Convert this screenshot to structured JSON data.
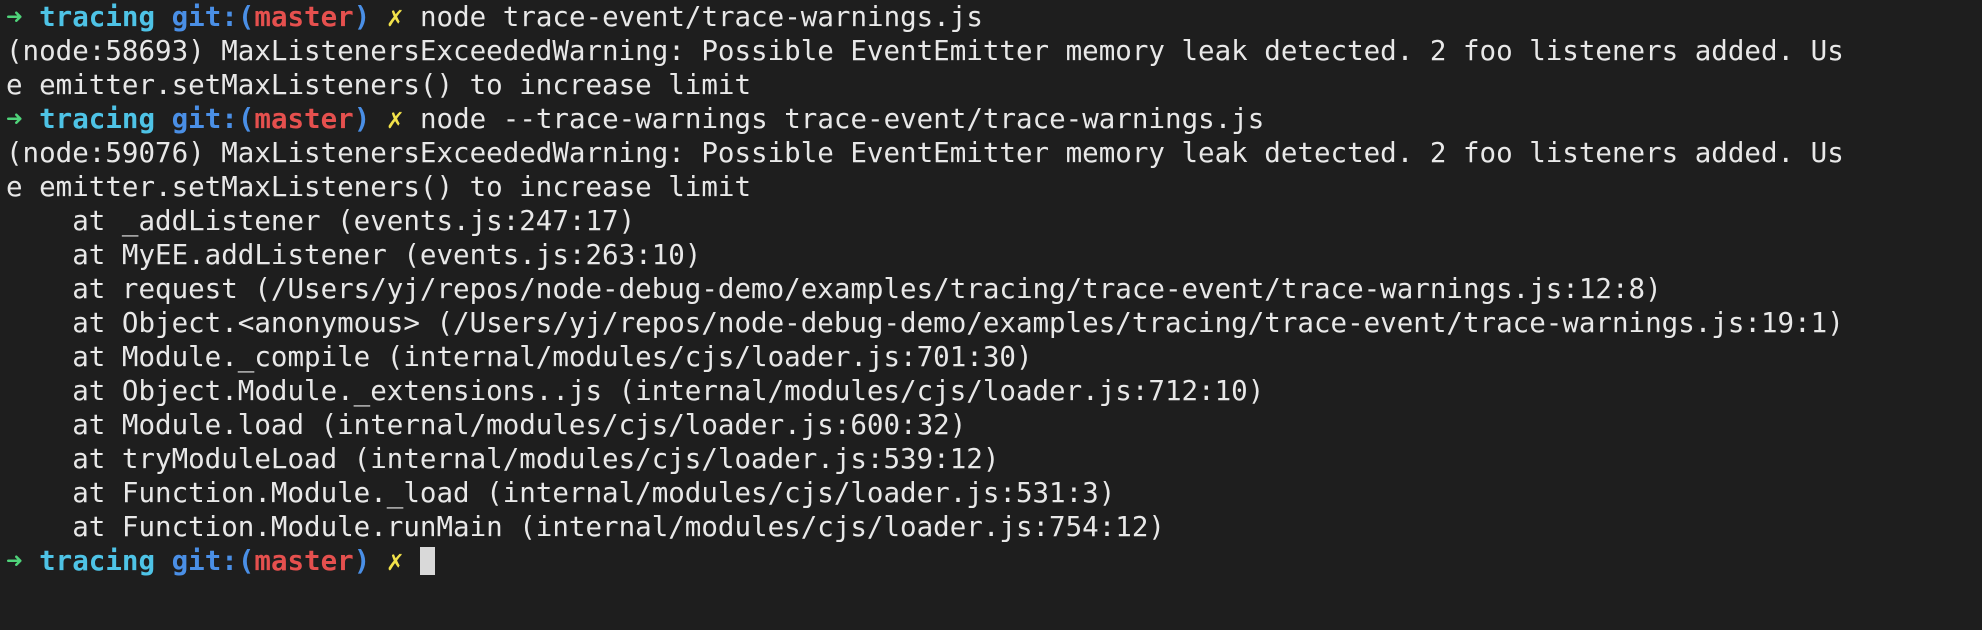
{
  "terminal": {
    "lines": [
      {
        "type": "prompt",
        "arrow": "➜",
        "dir": "tracing",
        "git_open": "git:(",
        "branch": "master",
        "git_close": ")",
        "dirty": "✗",
        "command": "node trace-event/trace-warnings.js"
      },
      {
        "type": "output",
        "text": "(node:58693) MaxListenersExceededWarning: Possible EventEmitter memory leak detected. 2 foo listeners added. Us"
      },
      {
        "type": "output",
        "text": "e emitter.setMaxListeners() to increase limit"
      },
      {
        "type": "prompt",
        "arrow": "➜",
        "dir": "tracing",
        "git_open": "git:(",
        "branch": "master",
        "git_close": ")",
        "dirty": "✗",
        "command": "node --trace-warnings trace-event/trace-warnings.js"
      },
      {
        "type": "output",
        "text": "(node:59076) MaxListenersExceededWarning: Possible EventEmitter memory leak detected. 2 foo listeners added. Us"
      },
      {
        "type": "output",
        "text": "e emitter.setMaxListeners() to increase limit"
      },
      {
        "type": "output",
        "text": "    at _addListener (events.js:247:17)"
      },
      {
        "type": "output",
        "text": "    at MyEE.addListener (events.js:263:10)"
      },
      {
        "type": "output",
        "text": "    at request (/Users/yj/repos/node-debug-demo/examples/tracing/trace-event/trace-warnings.js:12:8)"
      },
      {
        "type": "output",
        "text": "    at Object.<anonymous> (/Users/yj/repos/node-debug-demo/examples/tracing/trace-event/trace-warnings.js:19:1)"
      },
      {
        "type": "output",
        "text": "    at Module._compile (internal/modules/cjs/loader.js:701:30)"
      },
      {
        "type": "output",
        "text": "    at Object.Module._extensions..js (internal/modules/cjs/loader.js:712:10)"
      },
      {
        "type": "output",
        "text": "    at Module.load (internal/modules/cjs/loader.js:600:32)"
      },
      {
        "type": "output",
        "text": "    at tryModuleLoad (internal/modules/cjs/loader.js:539:12)"
      },
      {
        "type": "output",
        "text": "    at Function.Module._load (internal/modules/cjs/loader.js:531:3)"
      },
      {
        "type": "output",
        "text": "    at Function.Module.runMain (internal/modules/cjs/loader.js:754:12)"
      },
      {
        "type": "prompt",
        "arrow": "➜",
        "dir": "tracing",
        "git_open": "git:(",
        "branch": "master",
        "git_close": ")",
        "dirty": "✗",
        "command": "",
        "cursor": true
      }
    ]
  },
  "colors": {
    "background": "#1e1e1e",
    "text": "#e8e8e8",
    "arrow": "#4fd37a",
    "dir": "#4ec3e6",
    "git": "#4a8fe6",
    "branch": "#e5504e",
    "dirty": "#f2e24a"
  }
}
